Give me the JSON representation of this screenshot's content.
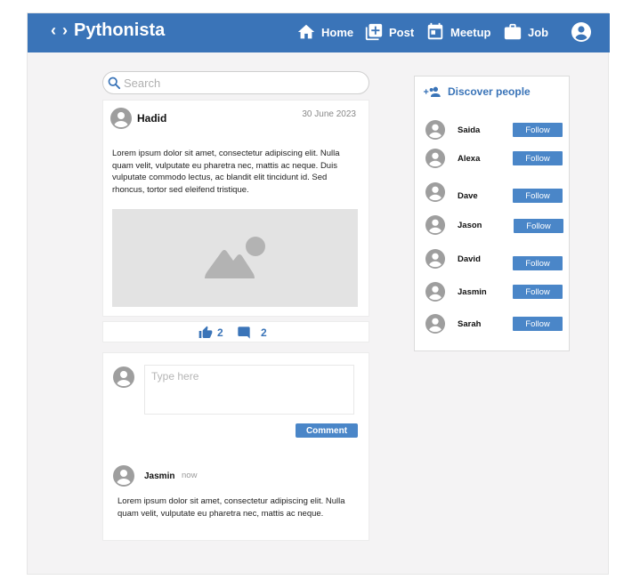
{
  "brand": {
    "name": "Pythonista",
    "icon": "code-brackets-icon"
  },
  "nav": {
    "items": [
      {
        "label": "Home",
        "icon": "home-icon"
      },
      {
        "label": "Post",
        "icon": "add-box-icon"
      },
      {
        "label": "Meetup",
        "icon": "calendar-icon"
      },
      {
        "label": "Job",
        "icon": "briefcase-icon"
      }
    ],
    "profile_icon": "account-circle-icon"
  },
  "search": {
    "placeholder": "Search"
  },
  "post": {
    "author": "Hadid",
    "date": "30 June 2023",
    "text": "Lorem ipsum dolor sit amet, consectetur adipiscing elit. Nulla quam velit, vulputate eu pharetra nec, mattis ac neque. Duis vulputate commodo lectus, ac blandit elit tincidunt id. Sed rhoncus, tortor sed eleifend tristique.",
    "likes": "2",
    "comments": "2"
  },
  "comment_box": {
    "placeholder": "Type here",
    "button_label": "Comment"
  },
  "comment": {
    "author": "Jasmin",
    "time": "now",
    "text": "Lorem ipsum dolor sit amet, consectetur adipiscing elit. Nulla quam velit, vulputate eu pharetra nec, mattis ac neque."
  },
  "discover": {
    "title": "Discover people",
    "people": [
      {
        "name": "Saida",
        "button": "Follow"
      },
      {
        "name": "Alexa",
        "button": "Follow"
      },
      {
        "name": "Dave",
        "button": "Follow"
      },
      {
        "name": "Jason",
        "button": "Follow"
      },
      {
        "name": "David",
        "button": "Follow"
      },
      {
        "name": "Jasmin",
        "button": "Follow"
      },
      {
        "name": "Sarah",
        "button": "Follow"
      }
    ]
  },
  "colors": {
    "primary": "#3a74b8",
    "button": "#4a86c8",
    "background": "#f4f3f4",
    "avatar": "#9e9e9e"
  }
}
